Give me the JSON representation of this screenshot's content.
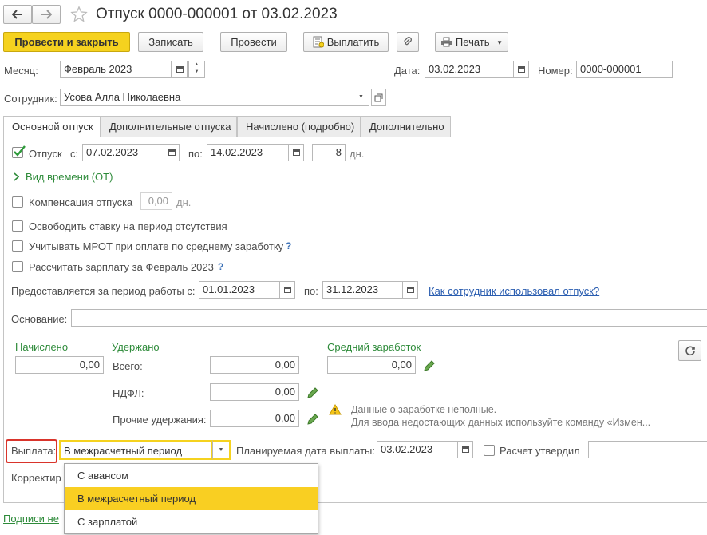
{
  "window": {
    "title": "Отпуск 0000-000001 от 03.02.2023"
  },
  "toolbar": {
    "post_close": "Провести и закрыть",
    "save": "Записать",
    "post": "Провести",
    "pay": "Выплатить",
    "print": "Печать"
  },
  "header": {
    "month_label": "Месяц:",
    "month_value": "Февраль 2023",
    "date_label": "Дата:",
    "date_value": "03.02.2023",
    "number_label": "Номер:",
    "number_value": "0000-000001",
    "employee_label": "Сотрудник:",
    "employee_value": "Усова Алла Николаевна"
  },
  "tabs": [
    {
      "label": "Основной отпуск"
    },
    {
      "label": "Дополнительные отпуска"
    },
    {
      "label": "Начислено (подробно)"
    },
    {
      "label": "Дополнительно"
    }
  ],
  "leave": {
    "checkbox_label": "Отпуск",
    "checked": true,
    "from_label": "с:",
    "from_value": "07.02.2023",
    "to_label": "по:",
    "to_value": "14.02.2023",
    "days_value": "8",
    "days_unit": "дн.",
    "time_type_link": "Вид времени (ОТ)"
  },
  "options": {
    "compensation_label": "Компенсация отпуска",
    "compensation_value": "0,00",
    "compensation_unit": "дн.",
    "release_rate": "Освободить ставку на период отсутствия",
    "mrot": "Учитывать МРОТ при оплате по среднему заработку",
    "calc_salary": "Рассчитать зарплату за Февраль 2023",
    "help_mark": "?"
  },
  "period": {
    "label": "Предоставляется за период работы с:",
    "from_value": "01.01.2023",
    "to_label": "по:",
    "to_value": "31.12.2023",
    "link": "Как сотрудник использовал отпуск?"
  },
  "basis": {
    "label": "Основание:",
    "value": ""
  },
  "totals": {
    "accrued_label": "Начислено",
    "accrued_value": "0,00",
    "withheld_label": "Удержано",
    "total_label": "Всего:",
    "total_value": "0,00",
    "ndfl_label": "НДФЛ:",
    "ndfl_value": "0,00",
    "other_label": "Прочие удержания:",
    "other_value": "0,00",
    "avg_label": "Средний заработок",
    "avg_value": "0,00",
    "warning_line1": "Данные о заработке неполные.",
    "warning_line2": "Для ввода недостающих данных используйте команду «Измен..."
  },
  "payment": {
    "label": "Выплата:",
    "value": "В межрасчетный период",
    "planned_date_label": "Планируемая дата выплаты:",
    "planned_date_value": "03.02.2023",
    "approved_label": "Расчет утвердил",
    "corrector_label": "Корректир",
    "options": [
      "С авансом",
      "В межрасчетный период",
      "С зарплатой"
    ],
    "selected_index": 1
  },
  "footer": {
    "signatures_link": "Подписи не"
  },
  "colors": {
    "accent": "#f5d21f",
    "green": "#2e8b3a",
    "link": "#2a5db0",
    "highlight_border": "#d9342b"
  }
}
